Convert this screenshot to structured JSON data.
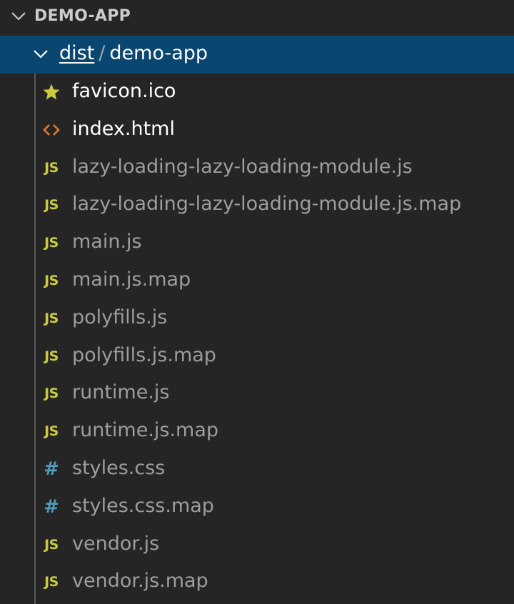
{
  "explorer": {
    "root_title": "DEMO-APP",
    "folder": {
      "segment_1": "dist",
      "separator": "/",
      "segment_2": "demo-app"
    },
    "files": [
      {
        "name": "favicon.ico",
        "icon": "star-icon",
        "style": "bright"
      },
      {
        "name": "index.html",
        "icon": "html-icon",
        "style": "bright"
      },
      {
        "name": "lazy-loading-lazy-loading-module.js",
        "icon": "js-icon",
        "style": "dim"
      },
      {
        "name": "lazy-loading-lazy-loading-module.js.map",
        "icon": "js-icon",
        "style": "dim"
      },
      {
        "name": "main.js",
        "icon": "js-icon",
        "style": "dim"
      },
      {
        "name": "main.js.map",
        "icon": "js-icon",
        "style": "dim"
      },
      {
        "name": "polyfills.js",
        "icon": "js-icon",
        "style": "dim"
      },
      {
        "name": "polyfills.js.map",
        "icon": "js-icon",
        "style": "dim"
      },
      {
        "name": "runtime.js",
        "icon": "js-icon",
        "style": "dim"
      },
      {
        "name": "runtime.js.map",
        "icon": "js-icon",
        "style": "dim"
      },
      {
        "name": "styles.css",
        "icon": "css-icon",
        "style": "dim"
      },
      {
        "name": "styles.css.map",
        "icon": "css-icon",
        "style": "dim"
      },
      {
        "name": "vendor.js",
        "icon": "js-icon",
        "style": "dim"
      },
      {
        "name": "vendor.js.map",
        "icon": "js-icon",
        "style": "dim"
      }
    ]
  },
  "icon_glyphs": {
    "js": "JS",
    "css": "#"
  },
  "colors": {
    "background": "#252526",
    "selection": "#094771",
    "js_icon": "#cbcb41",
    "css_icon": "#519aba",
    "html_icon": "#e37933",
    "star_icon": "#cbcb41"
  }
}
